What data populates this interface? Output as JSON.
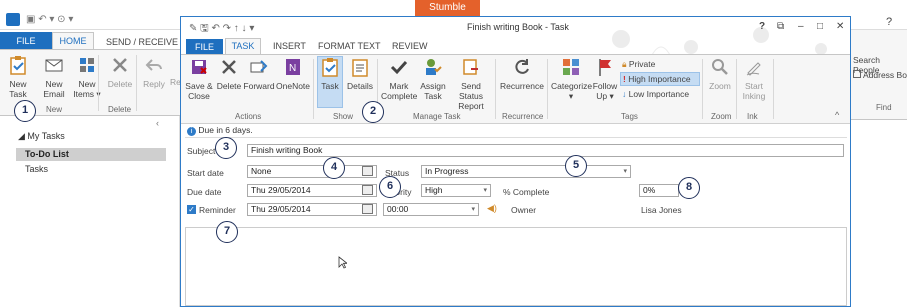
{
  "bg": {
    "stumble": "Stumble",
    "tabs": {
      "file": "FILE",
      "home": "HOME",
      "send_receive": "SEND / RECEIVE"
    },
    "buttons": {
      "new_task": [
        "New",
        "Task"
      ],
      "new_email": [
        "New",
        "Email"
      ],
      "new_items": [
        "New",
        "Items ▾"
      ],
      "delete": "Delete",
      "reply": "Reply",
      "re": "Re"
    },
    "groups": {
      "new": "New",
      "delete": "Delete"
    },
    "nav": {
      "my_tasks": "◢ My Tasks",
      "todo": "To-Do List",
      "tasks": "Tasks"
    },
    "right": {
      "search_people": "Search People",
      "address_book": "Address Bo",
      "find": "Find",
      "help": "?"
    }
  },
  "task_window": {
    "title": "Finish writing Book - Task",
    "window_buttons": {
      "help": "?",
      "restore": "⧉",
      "minimize": "–",
      "maximize": "□",
      "close": "✕"
    },
    "tabs": {
      "file": "FILE",
      "task": "TASK",
      "insert": "INSERT",
      "format_text": "FORMAT TEXT",
      "review": "REVIEW"
    },
    "ribbon": {
      "save_close": [
        "Save &",
        "Close"
      ],
      "delete": "Delete",
      "forward": "Forward",
      "onenote": "OneNote",
      "task": "Task",
      "details": "Details",
      "mark_complete": [
        "Mark",
        "Complete"
      ],
      "assign_task": [
        "Assign",
        "Task"
      ],
      "send_status_report": [
        "Send Status",
        "Report"
      ],
      "recurrence": "Recurrence",
      "categorize": [
        "Categorize",
        "▾"
      ],
      "follow_up": [
        "Follow",
        "Up ▾"
      ],
      "private": "Private",
      "high_importance": "High Importance",
      "low_importance": "Low Importance",
      "zoom": "Zoom",
      "start_inking": [
        "Start",
        "Inking"
      ],
      "groups": {
        "actions": "Actions",
        "show": "Show",
        "manage_task": "Manage Task",
        "recurrence": "Recurrence",
        "tags": "Tags",
        "zoom": "Zoom",
        "ink": "Ink"
      }
    },
    "info": "Due in 6 days.",
    "form": {
      "subject_label": "Subject",
      "subject_value": "Finish writing Book",
      "start_date_label": "Start date",
      "start_date_value": "None",
      "status_label": "Status",
      "status_value": "In Progress",
      "due_date_label": "Due date",
      "due_date_value": "Thu 29/05/2014",
      "priority_label": "Priority",
      "priority_value": "High",
      "percent_label": "% Complete",
      "percent_value": "0%",
      "reminder_label": "Reminder",
      "reminder_date": "Thu 29/05/2014",
      "reminder_time": "00:00",
      "owner_label": "Owner",
      "owner_value": "Lisa Jones"
    }
  },
  "callouts": [
    "1",
    "2",
    "3",
    "4",
    "5",
    "6",
    "7",
    "8"
  ]
}
